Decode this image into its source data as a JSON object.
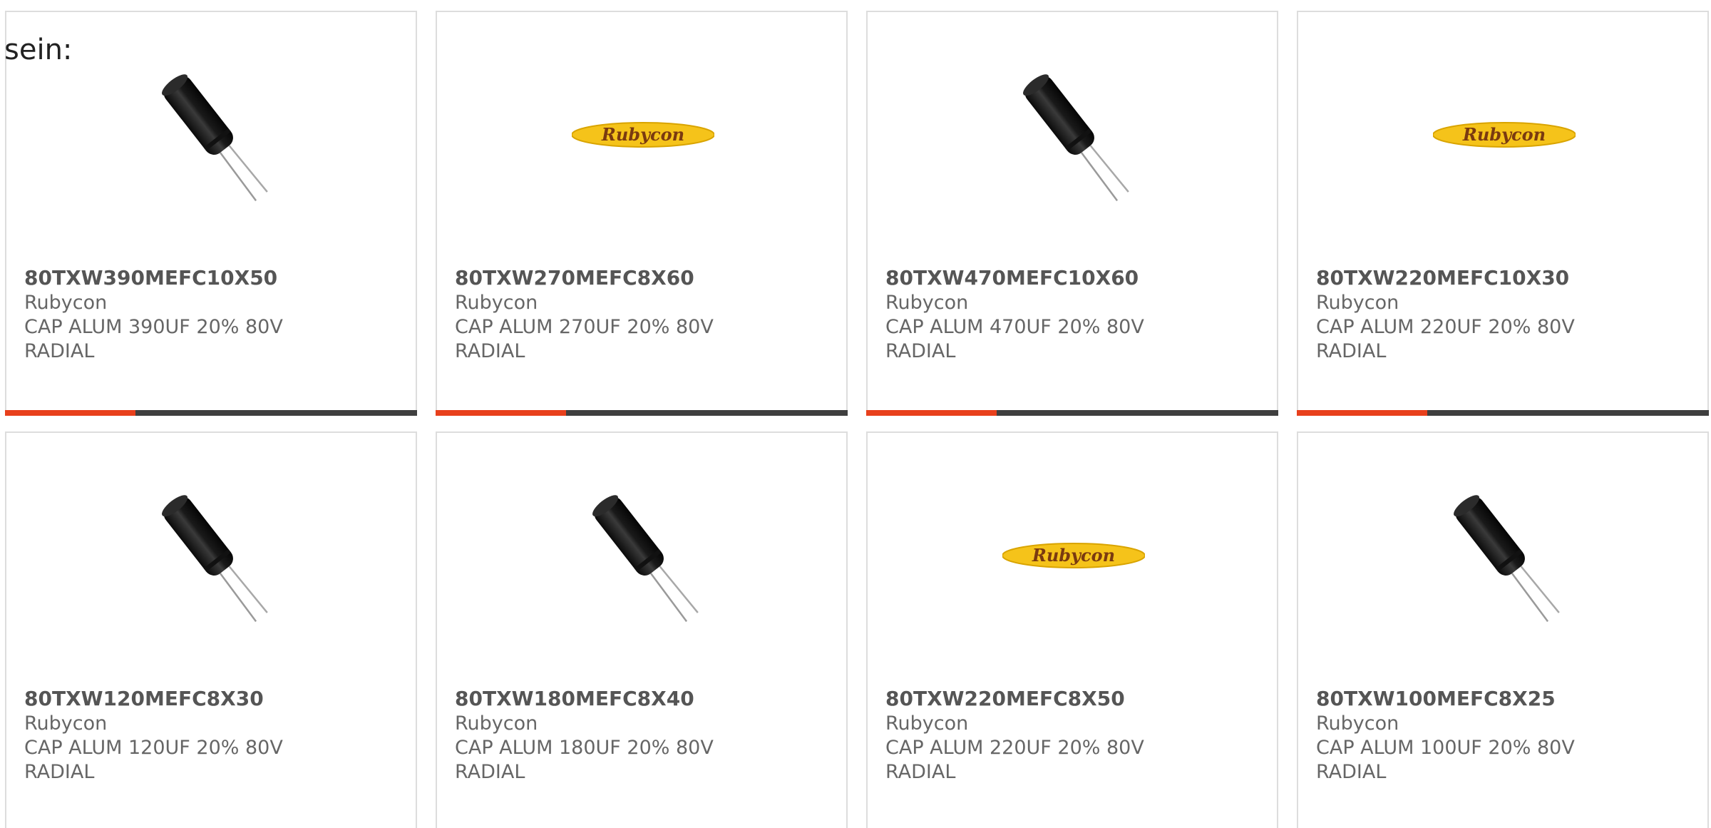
{
  "intro_text": "sein:",
  "colors": {
    "accent": "#e8401c",
    "bar": "#3f3f3f",
    "logo_yellow": "#f5c31a",
    "logo_text": "#7a3a10"
  },
  "products": [
    {
      "part": "80TXW390MEFC10X50",
      "manufacturer": "Rubycon",
      "description": "CAP ALUM 390UF 20% 80V RADIAL",
      "image": "capacitor-icon",
      "logo_text": ""
    },
    {
      "part": "80TXW270MEFC8X60",
      "manufacturer": "Rubycon",
      "description": "CAP ALUM 270UF 20% 80V RADIAL",
      "image": "rubycon-logo",
      "logo_text": "Rubycon"
    },
    {
      "part": "80TXW470MEFC10X60",
      "manufacturer": "Rubycon",
      "description": "CAP ALUM 470UF 20% 80V RADIAL",
      "image": "capacitor-icon",
      "logo_text": ""
    },
    {
      "part": "80TXW220MEFC10X30",
      "manufacturer": "Rubycon",
      "description": "CAP ALUM 220UF 20% 80V RADIAL",
      "image": "rubycon-logo",
      "logo_text": "Rubycon"
    },
    {
      "part": "80TXW120MEFC8X30",
      "manufacturer": "Rubycon",
      "description": "CAP ALUM 120UF 20% 80V RADIAL",
      "image": "capacitor-icon",
      "logo_text": ""
    },
    {
      "part": "80TXW180MEFC8X40",
      "manufacturer": "Rubycon",
      "description": "CAP ALUM 180UF 20% 80V RADIAL",
      "image": "capacitor-icon",
      "logo_text": ""
    },
    {
      "part": "80TXW220MEFC8X50",
      "manufacturer": "Rubycon",
      "description": "CAP ALUM 220UF 20% 80V RADIAL",
      "image": "rubycon-logo",
      "logo_text": "Rubycon"
    },
    {
      "part": "80TXW100MEFC8X25",
      "manufacturer": "Rubycon",
      "description": "CAP ALUM 100UF 20% 80V RADIAL",
      "image": "capacitor-icon",
      "logo_text": ""
    }
  ]
}
